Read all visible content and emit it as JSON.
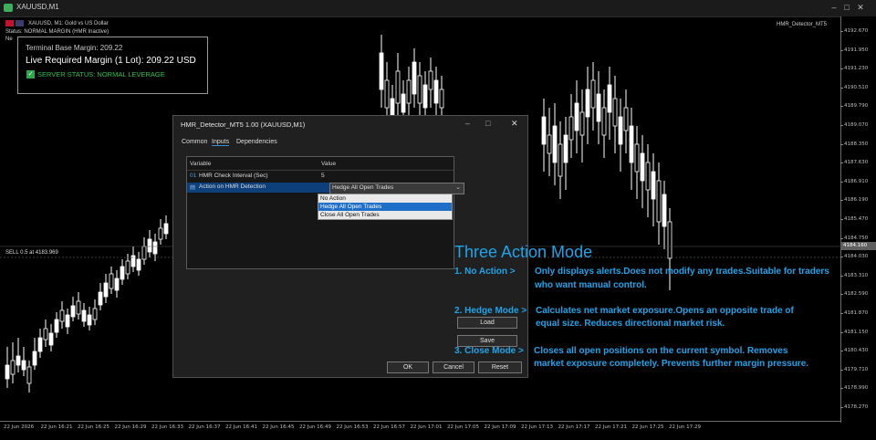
{
  "window": {
    "title": "XAUUSD,M1"
  },
  "chart": {
    "symbol_line": "XAUUSD, M1:  Gold vs US Dollar",
    "status_line": "Status: NORMAL MARGIN (HMR Inactive)",
    "status_line2": "Ne",
    "indicator": "HMR_Detector_MT5",
    "sell_line": "SELL 0.5 at 4183.969",
    "current_price": "4184.160",
    "price_ticks": [
      "4192.670",
      "4191.950",
      "4191.230",
      "4190.510",
      "4189.790",
      "4189.070",
      "4188.350",
      "4187.630",
      "4186.910",
      "4186.190",
      "4185.470",
      "4184.750",
      "4184.030",
      "4183.310",
      "4182.590",
      "4181.870",
      "4181.150",
      "4180.430",
      "4179.710",
      "4178.990",
      "4178.270"
    ],
    "time_ticks": [
      "22 Jun 2026",
      "22 Jun 16:21",
      "22 Jun 16:25",
      "22 Jun 16:29",
      "22 Jun 16:33",
      "22 Jun 16:37",
      "22 Jun 16:41",
      "22 Jun 16:45",
      "22 Jun 16:49",
      "22 Jun 16:53",
      "22 Jun 16:57",
      "22 Jun 17:01",
      "22 Jun 17:05",
      "22 Jun 17:09",
      "22 Jun 17:13",
      "22 Jun 17:17",
      "22 Jun 17:21",
      "22 Jun 17:25",
      "22 Jun 17:29"
    ]
  },
  "margin_panel": {
    "base": "Terminal Base Margin: 209.22",
    "live": "Live Required Margin (1 Lot): 209.22 USD",
    "server": "SERVER STATUS: NORMAL LEVERAGE"
  },
  "dialog": {
    "title": "HMR_Detector_MT5 1.00 (XAUUSD,M1)",
    "tabs": [
      "Common",
      "Inputs",
      "Dependencies"
    ],
    "col_variable": "Variable",
    "col_value": "Value",
    "row1_prefix": "01",
    "row1_name": "HMR Check Interval (Sec)",
    "row1_value": "5",
    "row2_name": "Action on HMR Detection",
    "row2_value": "Hedge All Open Trades",
    "options": [
      "No Action",
      "Hedge All Open Trades",
      "Close All Open Trades"
    ],
    "load": "Load",
    "save": "Save",
    "ok": "OK",
    "cancel": "Cancel",
    "reset": "Reset"
  },
  "annotations": {
    "title": "Three Action Mode",
    "m1_label": "1. No Action >",
    "m1_desc": "Only displays alerts.Does not modify any trades.Suitable for traders who want manual control.",
    "m2_label": "2. Hedge Mode >",
    "m2_desc1": "Calculates net market exposure.Opens an opposite trade of",
    "m2_desc2": "equal size. Reduces directional market risk.",
    "m3_label": "3. Close Mode >",
    "m3_desc1": "Closes all open positions on the current symbol. Removes",
    "m3_desc2": "market exposure completely. Prevents further margin pressure."
  },
  "colors": {
    "bull": "#ffffff",
    "bear": "#000000",
    "accent": "#1fa4ea",
    "ok_green": "#2ec24f"
  }
}
